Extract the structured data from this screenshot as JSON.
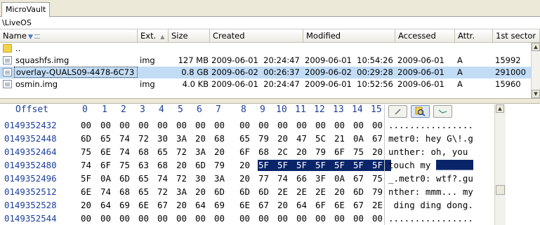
{
  "tab": {
    "label": "MicroVault"
  },
  "path": {
    "label": "\\LiveOS"
  },
  "columns": [
    {
      "label": "Name"
    },
    {
      "label": "Ext."
    },
    {
      "label": "Size"
    },
    {
      "label": "Created"
    },
    {
      "label": "Modified"
    },
    {
      "label": "Accessed"
    },
    {
      "label": "Attr."
    },
    {
      "label": "1st sector"
    }
  ],
  "files": [
    {
      "name": "..",
      "ext": "",
      "size": "",
      "created": "",
      "modified": "",
      "accessed": "",
      "attr": "",
      "sector": ""
    },
    {
      "name": "squashfs.img",
      "ext": "img",
      "size": "127 MB",
      "created": "2009-06-01  20:24:47",
      "modified": "2009-06-01  10:54:26",
      "accessed": "2009-06-01",
      "attr": "A",
      "sector": "15992"
    },
    {
      "name": "overlay-QUALS09-4478-6C73",
      "ext": "",
      "size": "0.8 GB",
      "created": "2009-06-02  00:26:37",
      "modified": "2009-06-02  00:29:28",
      "accessed": "2009-06-01",
      "attr": "A",
      "sector": "291000"
    },
    {
      "name": "osmin.img",
      "ext": "img",
      "size": "4.0 KB",
      "created": "2009-06-01  20:24:47",
      "modified": "2009-06-01  10:52:56",
      "accessed": "2009-06-01",
      "attr": "A",
      "sector": "15960"
    }
  ],
  "hex": {
    "offset_label": "Offset",
    "columns": [
      "0",
      "1",
      "2",
      "3",
      "4",
      "5",
      "6",
      "7",
      "8",
      "9",
      "10",
      "11",
      "12",
      "13",
      "14",
      "15"
    ],
    "rows": [
      {
        "offset": "0149352432",
        "bytes": [
          "00",
          "00",
          "00",
          "00",
          "00",
          "00",
          "00",
          "00",
          "00",
          "00",
          "00",
          "00",
          "00",
          "00",
          "00",
          "00"
        ],
        "text": "................"
      },
      {
        "offset": "0149352448",
        "bytes": [
          "6D",
          "65",
          "74",
          "72",
          "30",
          "3A",
          "20",
          "68",
          "65",
          "79",
          "20",
          "47",
          "5C",
          "21",
          "0A",
          "67"
        ],
        "text": "metr0: hey G\\!.g"
      },
      {
        "offset": "0149352464",
        "bytes": [
          "75",
          "6E",
          "74",
          "68",
          "65",
          "72",
          "3A",
          "20",
          "6F",
          "68",
          "2C",
          "20",
          "79",
          "6F",
          "75",
          "20"
        ],
        "text": "unther: oh, you "
      },
      {
        "offset": "0149352480",
        "bytes": [
          "74",
          "6F",
          "75",
          "63",
          "68",
          "20",
          "6D",
          "79",
          "20",
          "5F",
          "5F",
          "5F",
          "5F",
          "5F",
          "5F",
          "5F"
        ],
        "text": "touch my ",
        "text_sel": "_______"
      },
      {
        "offset": "0149352496",
        "bytes": [
          "5F",
          "0A",
          "6D",
          "65",
          "74",
          "72",
          "30",
          "3A",
          "20",
          "77",
          "74",
          "66",
          "3F",
          "0A",
          "67",
          "75"
        ],
        "text": "_.metr0: wtf?.gu"
      },
      {
        "offset": "0149352512",
        "bytes": [
          "6E",
          "74",
          "68",
          "65",
          "72",
          "3A",
          "20",
          "6D",
          "6D",
          "6D",
          "2E",
          "2E",
          "2E",
          "20",
          "6D",
          "79"
        ],
        "text": "nther: mmm... my"
      },
      {
        "offset": "0149352528",
        "bytes": [
          "20",
          "64",
          "69",
          "6E",
          "67",
          "20",
          "64",
          "69",
          "6E",
          "67",
          "20",
          "64",
          "6F",
          "6E",
          "67",
          "2E"
        ],
        "text": " ding ding dong."
      },
      {
        "offset": "0149352544",
        "bytes": [
          "00",
          "00",
          "00",
          "00",
          "00",
          "00",
          "00",
          "00",
          "00",
          "00",
          "00",
          "00",
          "00",
          "00",
          "00",
          "00"
        ],
        "text": "................"
      }
    ]
  }
}
